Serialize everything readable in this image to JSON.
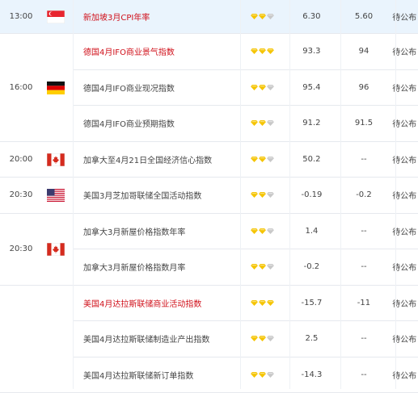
{
  "rows": [
    {
      "event": "新加坡3月CPI年率",
      "prev": "6.30",
      "forecast": "5.60",
      "status": "待公布",
      "stars": 2,
      "red": true,
      "hl": true
    },
    {
      "event": "德国4月IFO商业景气指数",
      "prev": "93.3",
      "forecast": "94",
      "status": "待公布",
      "stars": 3,
      "red": true,
      "hl": false
    },
    {
      "event": "德国4月IFO商业现况指数",
      "prev": "95.4",
      "forecast": "96",
      "status": "待公布",
      "stars": 2,
      "red": false,
      "hl": false
    },
    {
      "event": "德国4月IFO商业预期指数",
      "prev": "91.2",
      "forecast": "91.5",
      "status": "待公布",
      "stars": 2,
      "red": false,
      "hl": false
    },
    {
      "event": "加拿大至4月21日全国经济信心指数",
      "prev": "50.2",
      "forecast": "--",
      "status": "待公布",
      "stars": 2,
      "red": false,
      "hl": false
    },
    {
      "event": "美国3月芝加哥联储全国活动指数",
      "prev": "-0.19",
      "forecast": "-0.2",
      "status": "待公布",
      "stars": 2,
      "red": false,
      "hl": false
    },
    {
      "event": "加拿大3月新屋价格指数年率",
      "prev": "1.4",
      "forecast": "--",
      "status": "待公布",
      "stars": 2,
      "red": false,
      "hl": false
    },
    {
      "event": "加拿大3月新屋价格指数月率",
      "prev": "-0.2",
      "forecast": "--",
      "status": "待公布",
      "stars": 2,
      "red": false,
      "hl": false
    },
    {
      "event": "美国4月达拉斯联储商业活动指数",
      "prev": "-15.7",
      "forecast": "-11",
      "status": "待公布",
      "stars": 3,
      "red": true,
      "hl": false
    },
    {
      "event": "美国4月达拉斯联储制造业产出指数",
      "prev": "2.5",
      "forecast": "--",
      "status": "待公布",
      "stars": 2,
      "red": false,
      "hl": false
    },
    {
      "event": "美国4月达拉斯联储新订单指数",
      "prev": "-14.3",
      "forecast": "--",
      "status": "待公布",
      "stars": 2,
      "red": false,
      "hl": false
    }
  ],
  "groups": [
    {
      "time": "13:00",
      "flag": "singapore-flag",
      "rows": 1
    },
    {
      "time": "16:00",
      "flag": "germany-flag",
      "rows": 3
    },
    {
      "time": "20:00",
      "flag": "canada-flag",
      "rows": 1
    },
    {
      "time": "20:30",
      "flag": "usa-flag",
      "rows": 1
    },
    {
      "time": "20:30",
      "flag": "canada-flag",
      "rows": 2
    },
    {
      "time": "",
      "flag": "",
      "rows": 3
    }
  ],
  "colors": {
    "highlight": "#eaf4fd",
    "important_text": "#d0101a",
    "star_on": "#f5c400",
    "star_off": "#c8c8c8"
  }
}
